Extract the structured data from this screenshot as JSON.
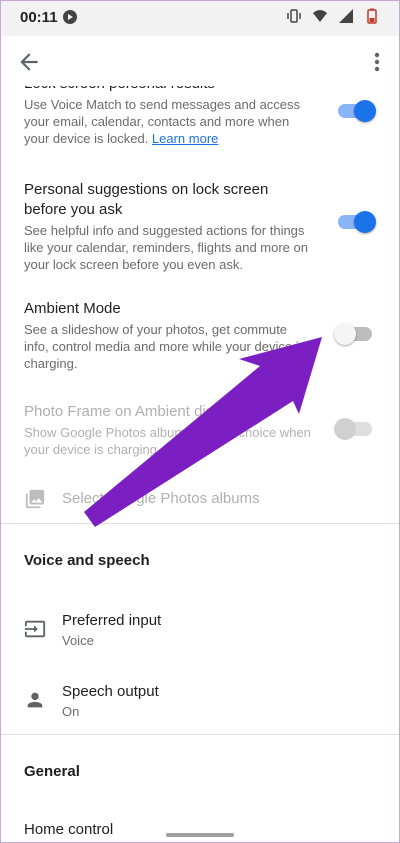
{
  "statusbar": {
    "time": "00:11"
  },
  "settings": [
    {
      "title": "Lock screen personal results",
      "subtitle": "Use Voice Match to send messages and access your email, calendar, contacts and more when your device is locked.",
      "link": "Learn more",
      "toggle": "on"
    },
    {
      "title": "Personal suggestions on lock screen before you ask",
      "subtitle": "See helpful info and suggested actions for things like your calendar, reminders, flights and more on your lock screen before you even ask.",
      "toggle": "on"
    },
    {
      "title": "Ambient Mode",
      "subtitle": "See a slideshow of your photos, get commute info, control media and more while your device is charging.",
      "toggle": "off"
    },
    {
      "title": "Photo Frame on Ambient display",
      "subtitle": "Show Google Photos albums of your choice when your device is charging.",
      "toggle": "disabled"
    }
  ],
  "select_albums": {
    "label": "Select Google Photos albums"
  },
  "voice_section": {
    "header": "Voice and speech",
    "items": [
      {
        "title": "Preferred input",
        "value": "Voice"
      },
      {
        "title": "Speech output",
        "value": "On"
      }
    ]
  },
  "general_section": {
    "header": "General",
    "partial_item": "Home control"
  },
  "colors": {
    "accent": "#1a73e8",
    "arrow": "#7b1fc2"
  }
}
